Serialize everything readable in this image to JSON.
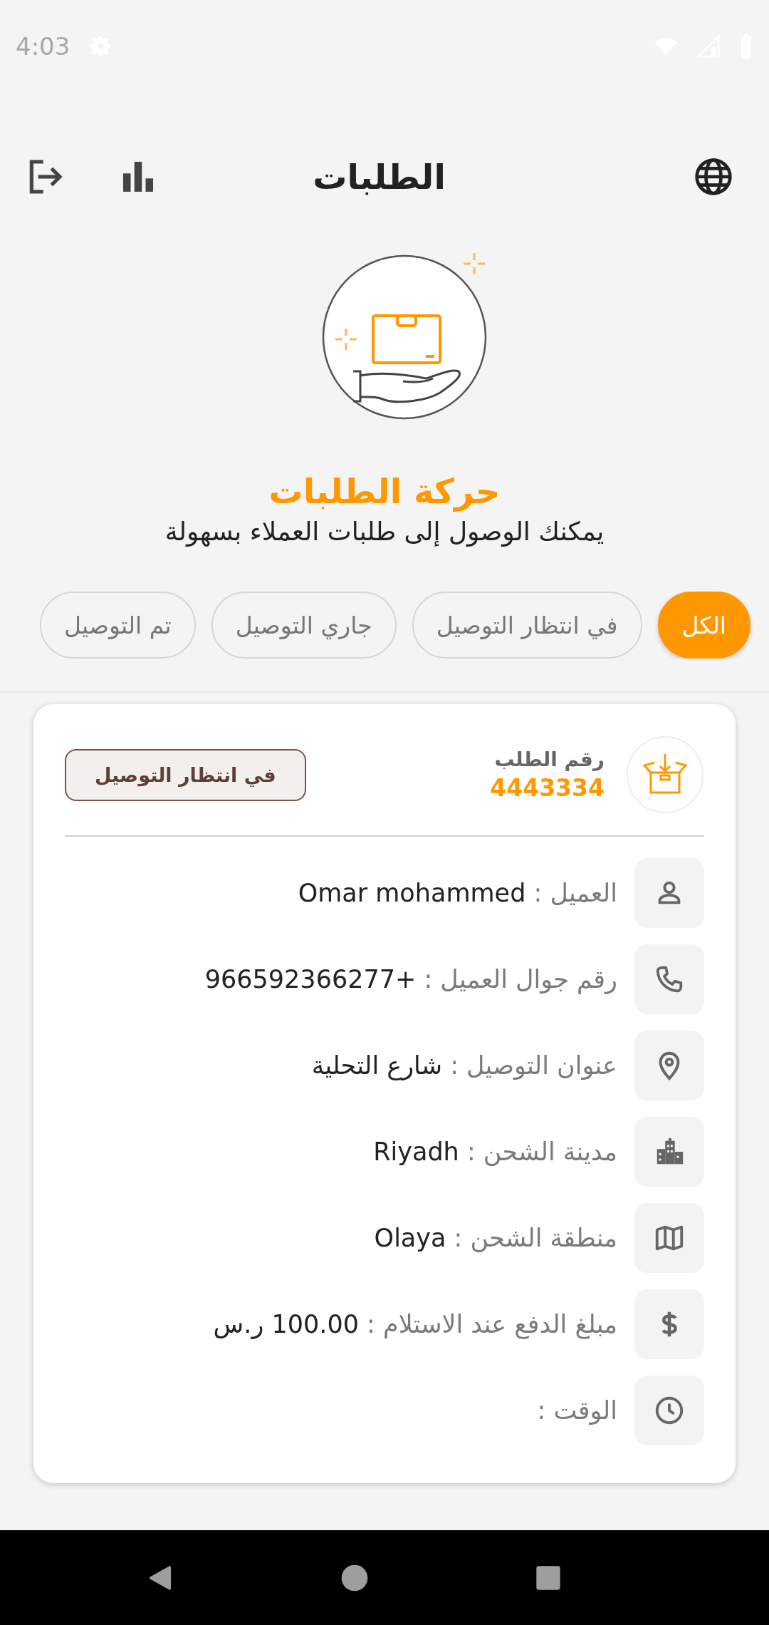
{
  "status_bar": {
    "time": "4:03"
  },
  "header": {
    "title": "الطلبات"
  },
  "hero": {
    "title": "حركة الطلبات",
    "subtitle": "يمكنك الوصول إلى طلبات العملاء بسهولة"
  },
  "filters": [
    {
      "label": "الكل",
      "selected": true
    },
    {
      "label": "في انتظار التوصيل",
      "selected": false
    },
    {
      "label": "جاري التوصيل",
      "selected": false
    },
    {
      "label": "تم التوصيل",
      "selected": false
    }
  ],
  "order": {
    "number_label": "رقم الطلب",
    "number": "4443334",
    "status": "في انتظار التوصيل",
    "fields": [
      {
        "kind": "person",
        "label": "العميل :",
        "value": "Omar mohammed"
      },
      {
        "kind": "phone",
        "label": "رقم جوال العميل :",
        "value": "+966592366277"
      },
      {
        "kind": "location",
        "label": "عنوان التوصيل :",
        "value": "شارع التحلية"
      },
      {
        "kind": "city",
        "label": "مدينة الشحن :",
        "value": "Riyadh"
      },
      {
        "kind": "map",
        "label": "منطقة الشحن :",
        "value": "Olaya"
      },
      {
        "kind": "money",
        "label": "مبلغ الدفع عند الاستلام :",
        "value": "100.00 ر.س"
      },
      {
        "kind": "time",
        "label": "الوقت :"
      }
    ]
  }
}
